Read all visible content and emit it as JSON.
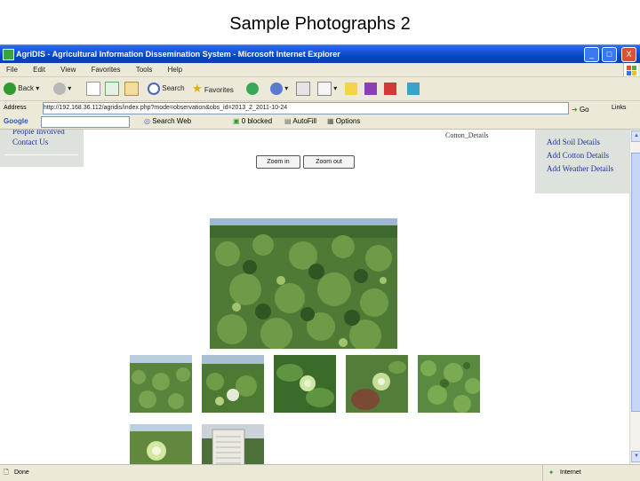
{
  "slide": {
    "title": "Sample Photographs 2"
  },
  "window": {
    "title": "AgriDIS - Agricultural Information Dissemination System - Microsoft Internet Explorer",
    "min_label": "_",
    "max_label": "□",
    "close_label": "X"
  },
  "menu": {
    "items": [
      "File",
      "Edit",
      "View",
      "Favorites",
      "Tools",
      "Help"
    ]
  },
  "toolbar": {
    "back_label": "Back",
    "search_label": "Search",
    "favorites_label": "Favorites"
  },
  "address": {
    "label": "Address",
    "url": "http://192.168.36.112/agridis/index.php?mode=observation&obs_id=2013_2_2011-10-24",
    "go_label": "Go",
    "links_label": "Links"
  },
  "google_bar": {
    "brand": "Google",
    "search_web_label": "Search Web",
    "blocked_label": "0 blocked",
    "autofill_label": "AutoFill",
    "options_label": "Options"
  },
  "left_sidebar": {
    "links": [
      "People Involved",
      "Contact Us"
    ]
  },
  "cotton_details_link": "Cotton_Details",
  "right_sidebar": {
    "links": [
      "Add Soil Details",
      "Add Cotton Details",
      "Add Weather Details"
    ]
  },
  "zoom": {
    "zoom_in_label": "Zoom in",
    "zoom_out_label": "Zoom out"
  },
  "status": {
    "text": "Done",
    "zone": "Internet"
  },
  "colors": {
    "titlebar": "#0a46c8",
    "chrome": "#ece9d8",
    "link": "#223399",
    "sidebar": "#dde3dc"
  }
}
